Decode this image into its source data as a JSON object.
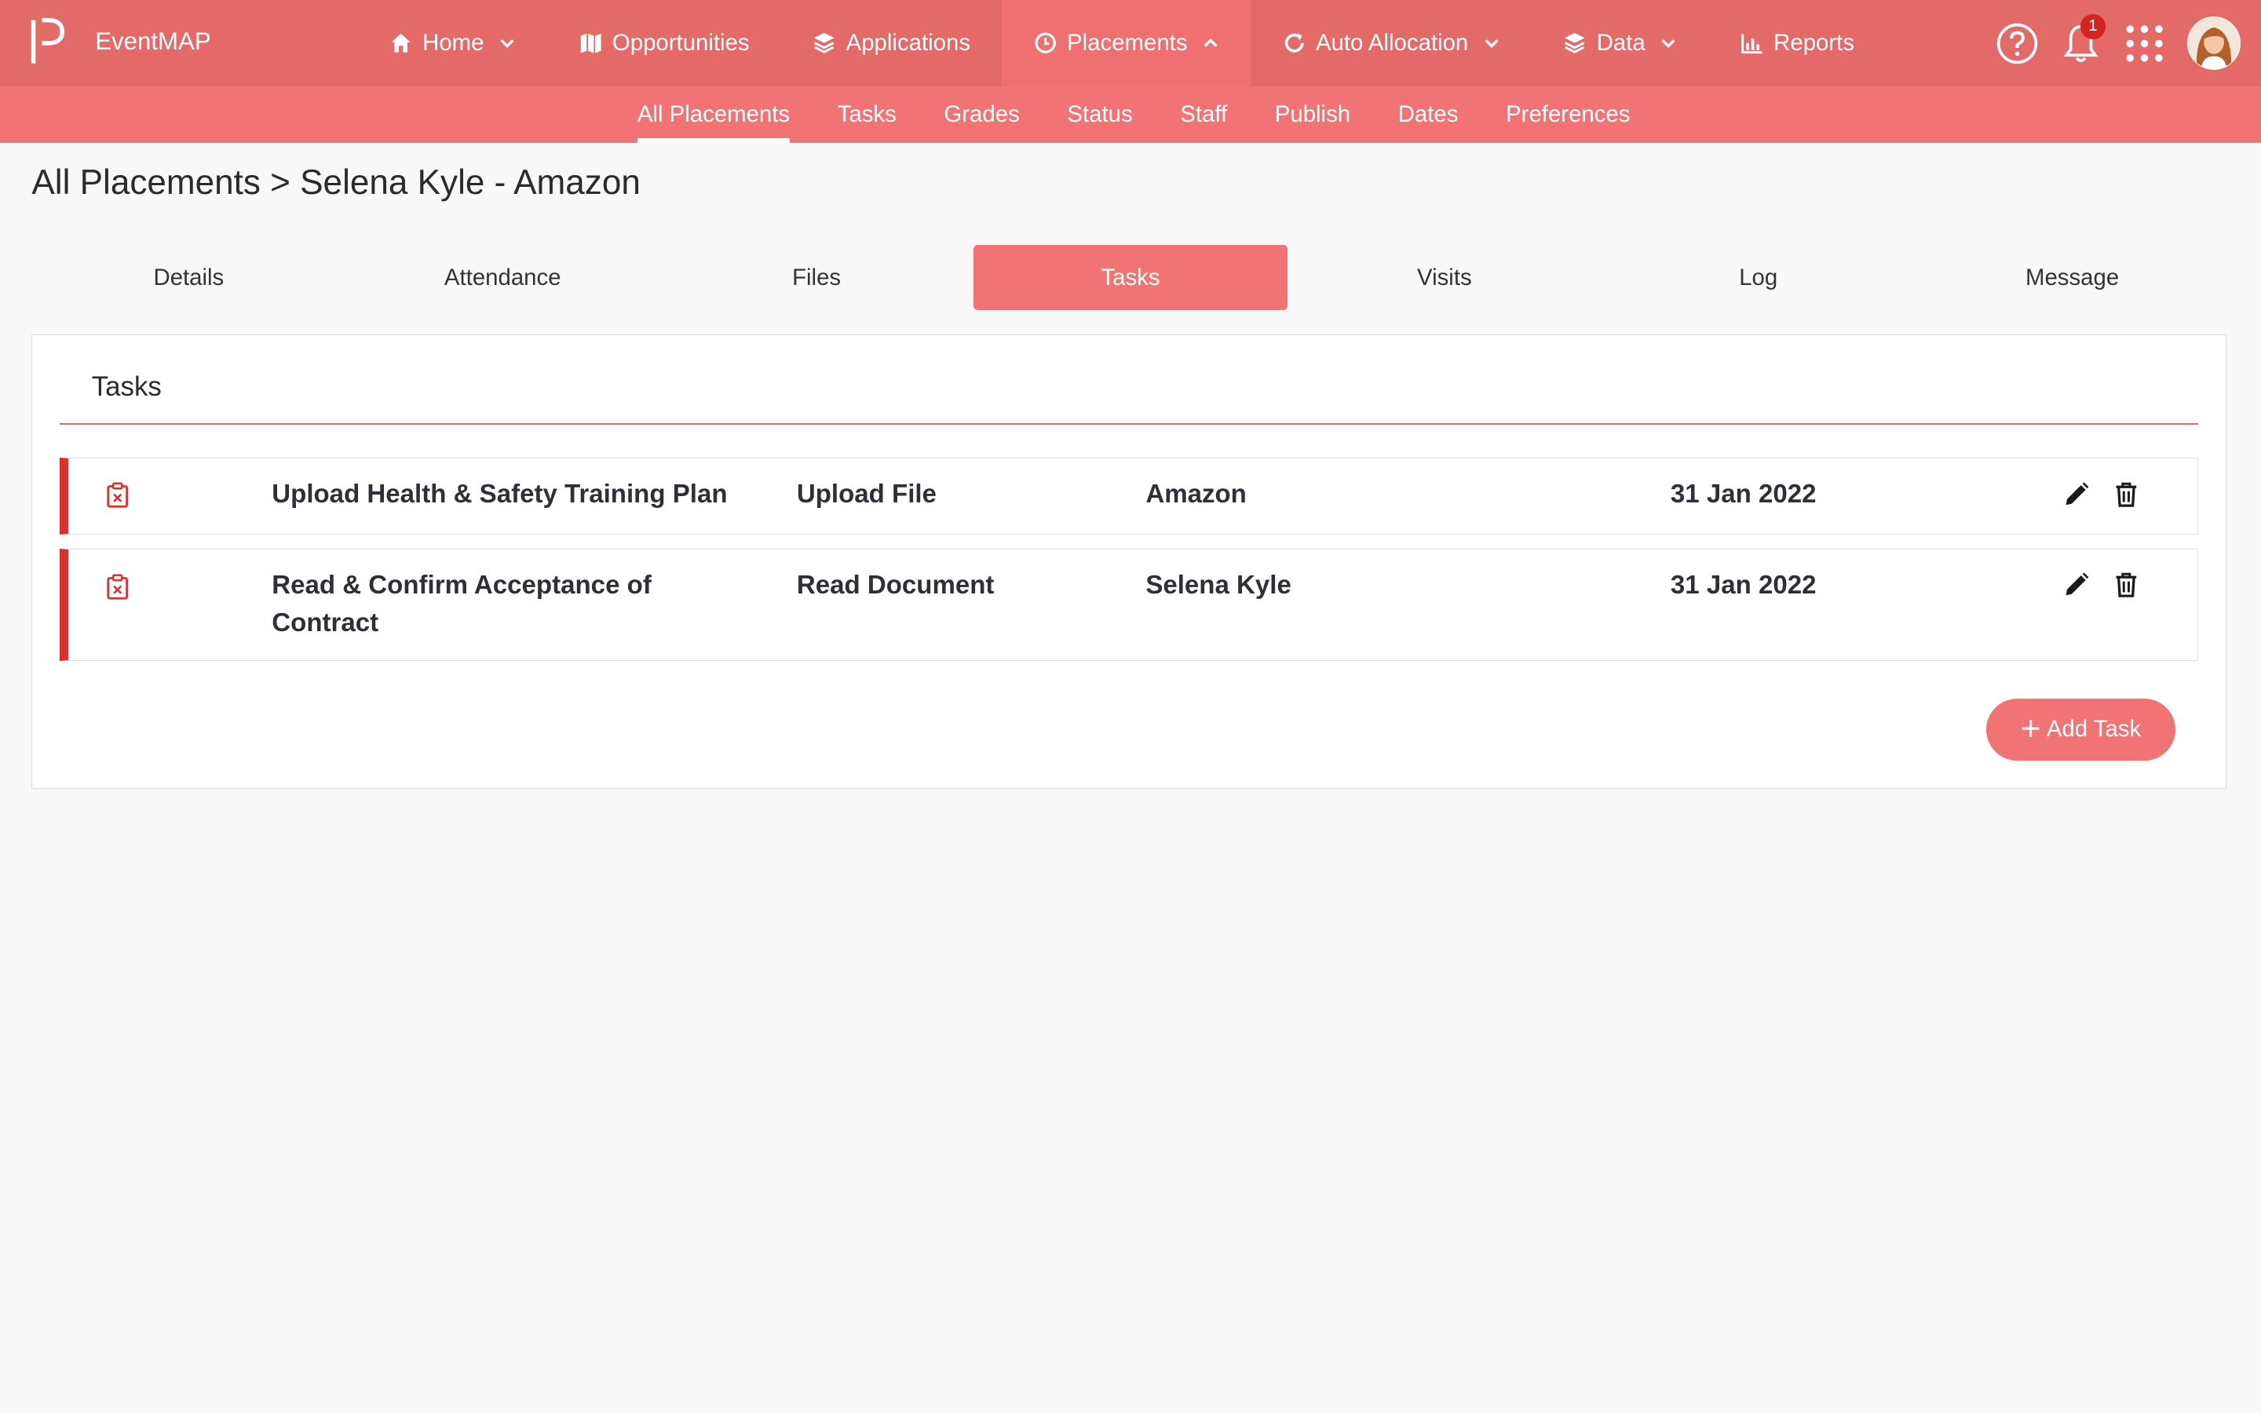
{
  "app": {
    "title": "EventMAP"
  },
  "nav": [
    {
      "label": "Home",
      "icon": "home-icon",
      "dropdown": true
    },
    {
      "label": "Opportunities",
      "icon": "map-icon",
      "dropdown": false
    },
    {
      "label": "Applications",
      "icon": "layers-icon",
      "dropdown": false
    },
    {
      "label": "Placements",
      "icon": "clock-icon",
      "dropdown": true,
      "active": true
    },
    {
      "label": "Auto Allocation",
      "icon": "refresh-icon",
      "dropdown": true
    },
    {
      "label": "Data",
      "icon": "layers-icon",
      "dropdown": true
    },
    {
      "label": "Reports",
      "icon": "bar-chart-icon",
      "dropdown": false
    }
  ],
  "notifications": {
    "count": "1"
  },
  "subnav": [
    {
      "label": "All Placements",
      "active": true
    },
    {
      "label": "Tasks"
    },
    {
      "label": "Grades"
    },
    {
      "label": "Status"
    },
    {
      "label": "Staff"
    },
    {
      "label": "Publish"
    },
    {
      "label": "Dates"
    },
    {
      "label": "Preferences"
    }
  ],
  "breadcrumb": "All Placements > Selena Kyle - Amazon",
  "tabs": [
    {
      "label": "Details"
    },
    {
      "label": "Attendance"
    },
    {
      "label": "Files"
    },
    {
      "label": "Tasks",
      "active": true
    },
    {
      "label": "Visits"
    },
    {
      "label": "Log"
    },
    {
      "label": "Message"
    }
  ],
  "panel": {
    "title": "Tasks"
  },
  "tasks": [
    {
      "name": "Upload Health & Safety Training Plan",
      "type": "Upload File",
      "assignee": "Amazon",
      "date": "31 Jan 2022"
    },
    {
      "name": "Read & Confirm Acceptance of Contract",
      "type": "Read Document",
      "assignee": "Selena Kyle",
      "date": "31 Jan 2022"
    }
  ],
  "add_task_label": "Add Task",
  "colors": {
    "topbar": "#e46a68",
    "subbar": "#f17373",
    "accent": "#dc2f2f"
  }
}
